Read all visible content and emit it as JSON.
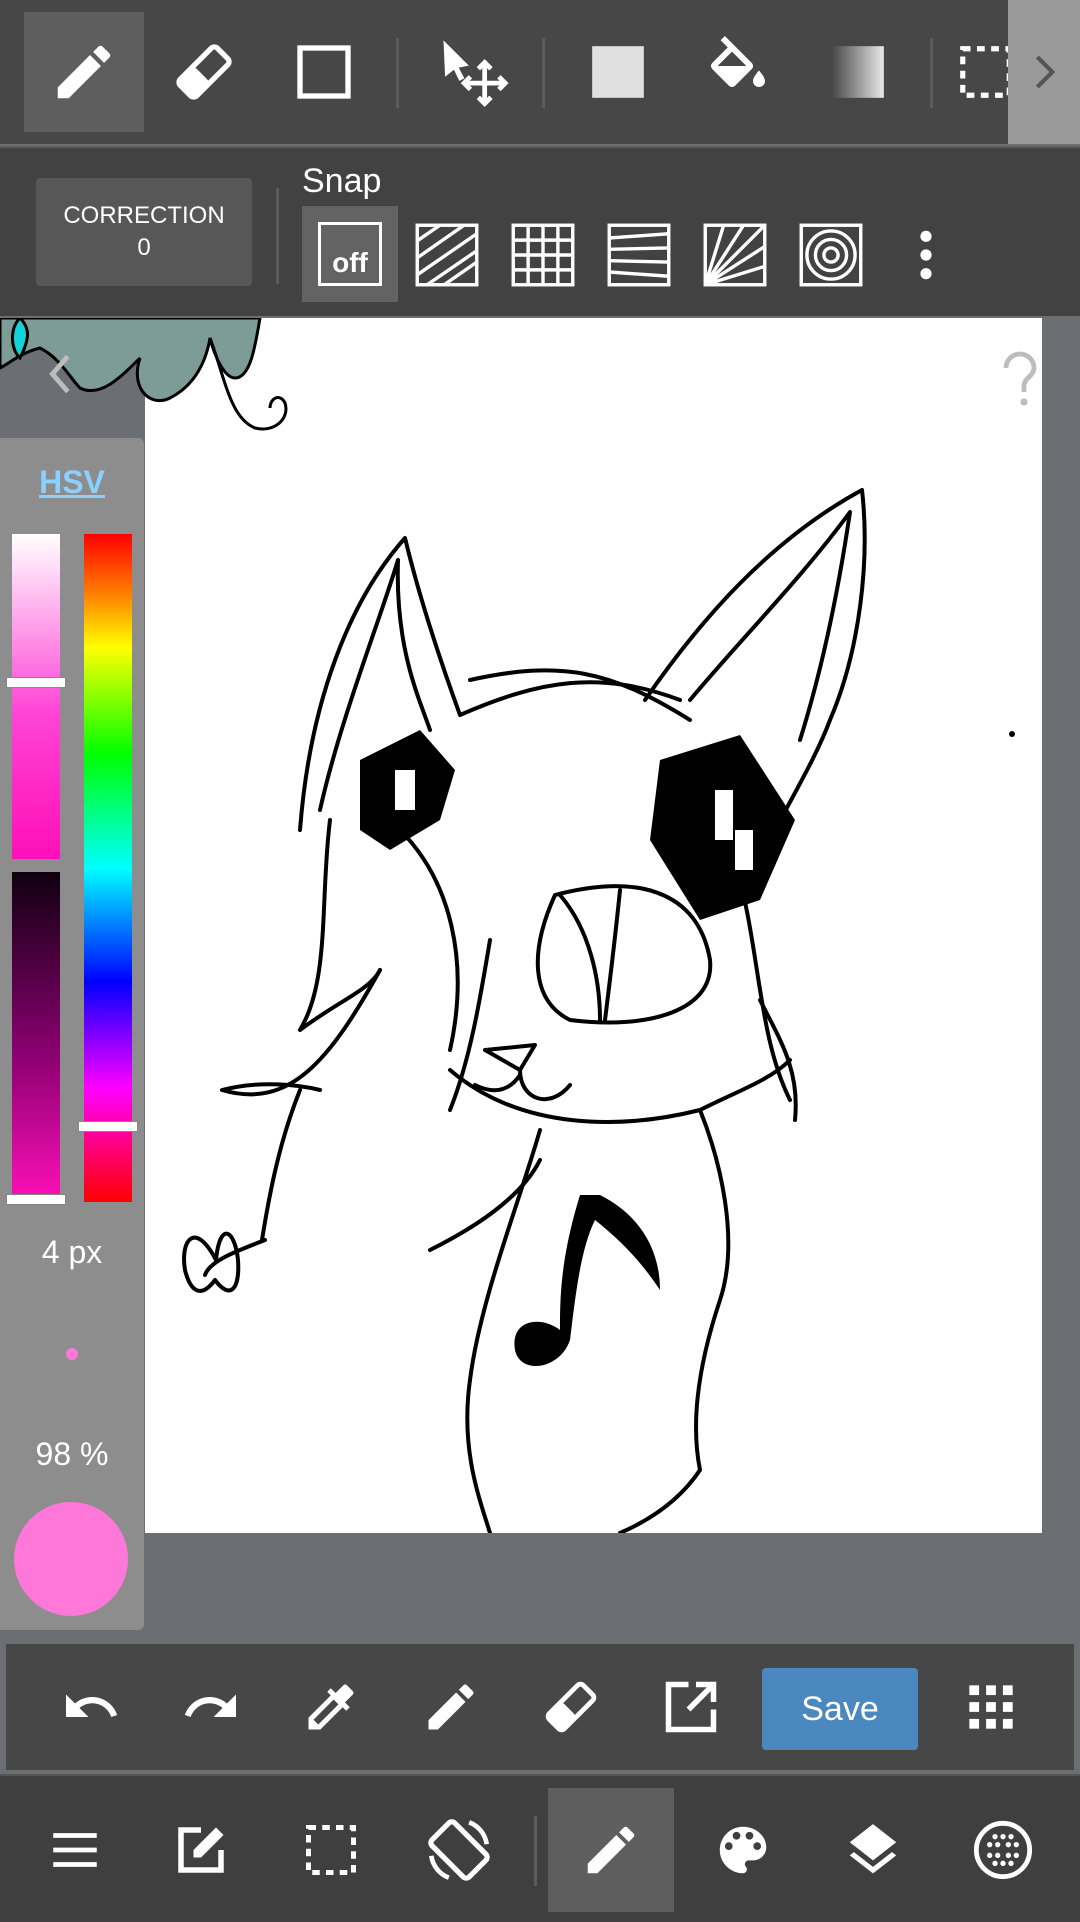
{
  "toolbar": {
    "tools": [
      "brush-tool",
      "eraser-tool",
      "shape-tool",
      "move-tool",
      "fill-rect-tool",
      "bucket-tool",
      "gradient-tool",
      "select-tool"
    ],
    "active_tool": "brush-tool"
  },
  "snap_bar": {
    "correction_label": "CORRECTION",
    "correction_value": "0",
    "snap_title": "Snap",
    "off_label": "off",
    "active_snap": "off"
  },
  "color_panel": {
    "mode_label": "HSV",
    "brush_size": "4 px",
    "opacity": "98 %",
    "color": "#ff77d8",
    "hue_level": 0.89,
    "saturation_level": 0.45,
    "value_level": 1.0
  },
  "action_bar": {
    "save_label": "Save"
  },
  "nav_bar": {
    "active_item": "brush"
  },
  "colors": {
    "toolbar_bg": "#474747",
    "accent": "#4a88bf",
    "canvas_bg": "#ffffff",
    "workspace_bg": "#6b6e73"
  }
}
